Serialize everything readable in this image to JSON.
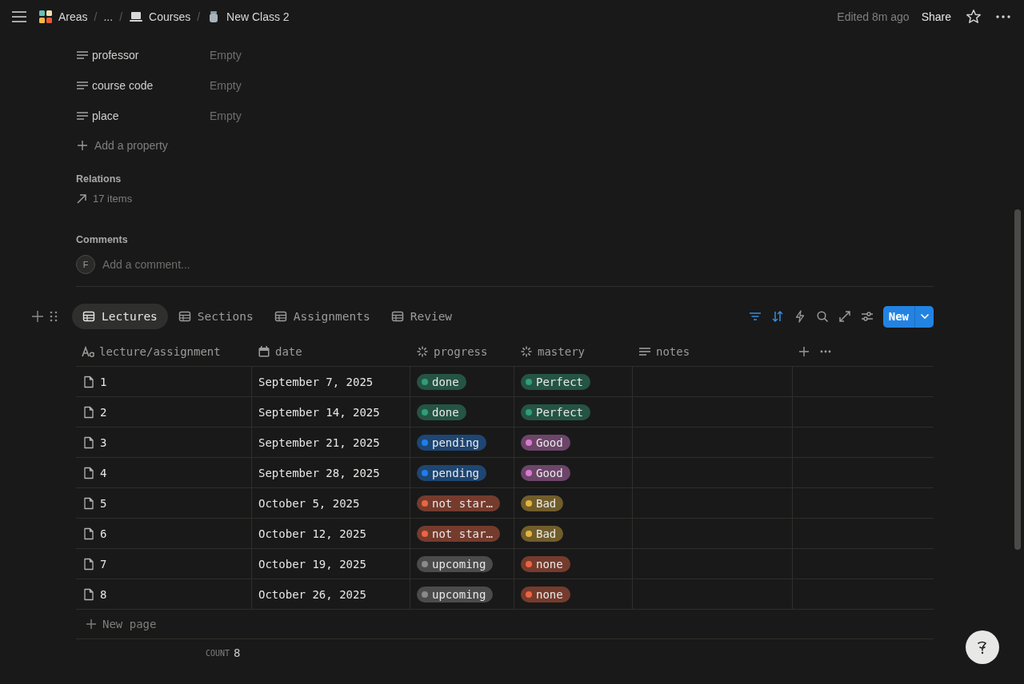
{
  "breadcrumb": [
    {
      "label": "Areas",
      "kind": "area"
    },
    {
      "separator": "/",
      "label": "...",
      "kind": "collapsed"
    },
    {
      "separator": "/",
      "label": "Courses",
      "kind": "database"
    },
    {
      "separator": "/",
      "label": "New Class 2",
      "kind": "page"
    }
  ],
  "topbar": {
    "edited": "Edited 8m ago",
    "share": "Share"
  },
  "properties": [
    {
      "name": "professor",
      "value": "Empty"
    },
    {
      "name": "course code",
      "value": "Empty"
    },
    {
      "name": "place",
      "value": "Empty"
    }
  ],
  "add_property": "Add a property",
  "relations": {
    "heading": "Relations",
    "items": "17 items"
  },
  "comments": {
    "heading": "Comments",
    "avatar": "F",
    "placeholder": "Add a comment..."
  },
  "views": [
    {
      "label": "Lectures",
      "selected": true
    },
    {
      "label": "Sections",
      "selected": false
    },
    {
      "label": "Assignments",
      "selected": false
    },
    {
      "label": "Review",
      "selected": false
    }
  ],
  "new_button": "New",
  "table": {
    "columns": [
      {
        "label": "lecture/assignment",
        "kind": "title"
      },
      {
        "label": "date",
        "kind": "date"
      },
      {
        "label": "progress",
        "kind": "status"
      },
      {
        "label": "mastery",
        "kind": "status"
      },
      {
        "label": "notes",
        "kind": "text"
      }
    ],
    "rows": [
      {
        "title": "1",
        "date": "September 7, 2025",
        "progress": {
          "label": "done",
          "color": "#2f9e78"
        },
        "mastery": {
          "label": "Perfect",
          "color": "#2f9e78"
        }
      },
      {
        "title": "2",
        "date": "September 14, 2025",
        "progress": {
          "label": "done",
          "color": "#2f9e78"
        },
        "mastery": {
          "label": "Perfect",
          "color": "#2f9e78"
        }
      },
      {
        "title": "3",
        "date": "September 21, 2025",
        "progress": {
          "label": "pending",
          "color": "#1f7ee8"
        },
        "mastery": {
          "label": "Good",
          "color": "#d87ad0"
        }
      },
      {
        "title": "4",
        "date": "September 28, 2025",
        "progress": {
          "label": "pending",
          "color": "#1f7ee8"
        },
        "mastery": {
          "label": "Good",
          "color": "#d87ad0"
        }
      },
      {
        "title": "5",
        "date": "October 5, 2025",
        "progress": {
          "label": "not star…",
          "color": "#ec6442"
        },
        "mastery": {
          "label": "Bad",
          "color": "#e4b53d"
        }
      },
      {
        "title": "6",
        "date": "October 12, 2025",
        "progress": {
          "label": "not star…",
          "color": "#ec6442"
        },
        "mastery": {
          "label": "Bad",
          "color": "#e4b53d"
        }
      },
      {
        "title": "7",
        "date": "October 19, 2025",
        "progress": {
          "label": "upcoming",
          "color": "#8a8a88"
        },
        "mastery": {
          "label": "none",
          "color": "#ec6442"
        }
      },
      {
        "title": "8",
        "date": "October 26, 2025",
        "progress": {
          "label": "upcoming",
          "color": "#8a8a88"
        },
        "mastery": {
          "label": "none",
          "color": "#ec6442"
        }
      }
    ],
    "new_page": "New page",
    "count_label": "COUNT",
    "count": "8"
  }
}
